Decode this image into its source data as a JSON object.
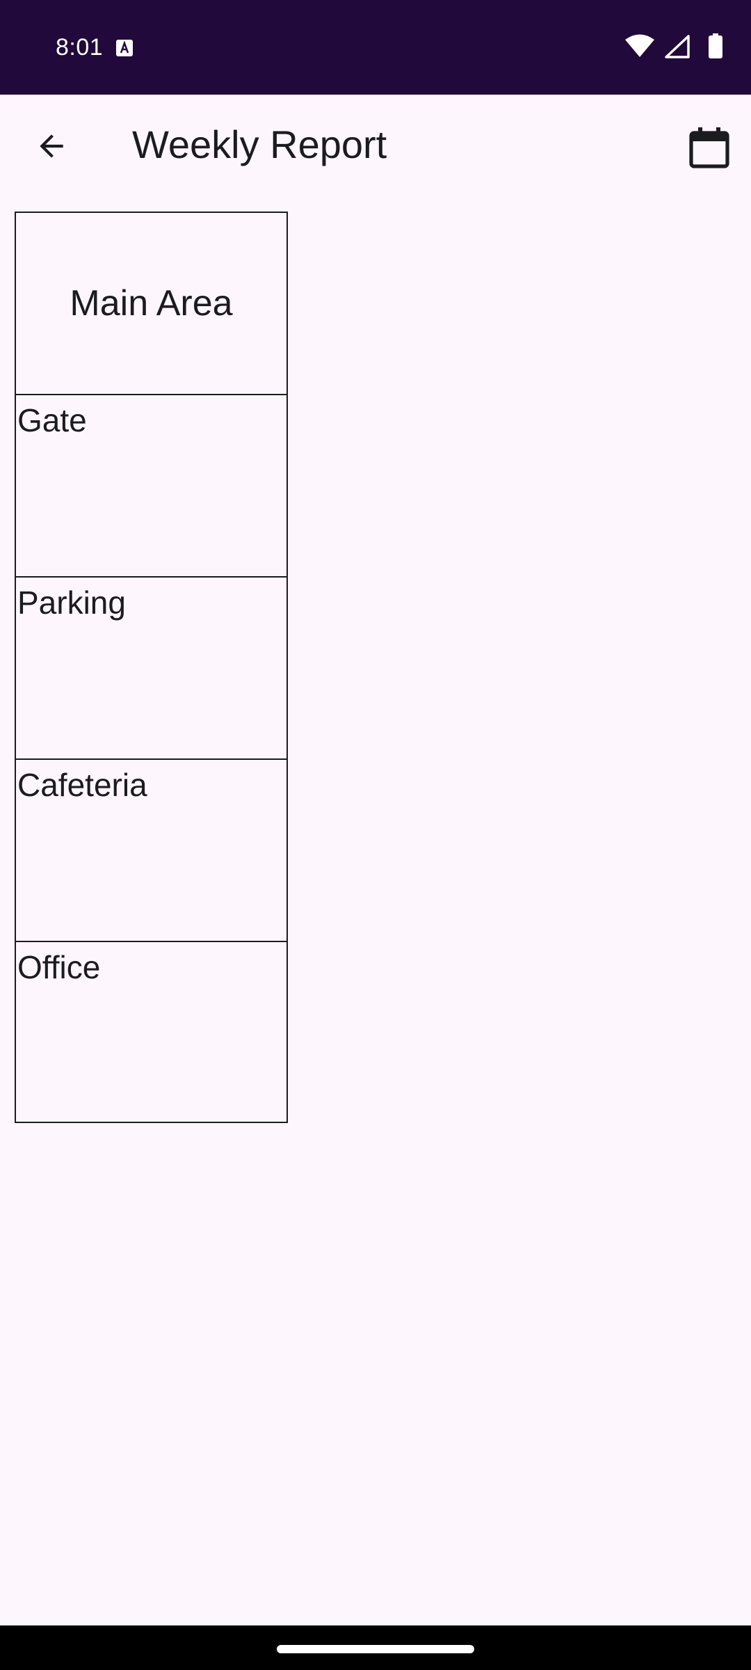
{
  "status_bar": {
    "time": "8:01",
    "icons": [
      "keyboard-a-icon",
      "wifi-icon",
      "signal-icon",
      "battery-icon"
    ]
  },
  "app_bar": {
    "title": "Weekly Report",
    "back_icon": "arrow-back-icon",
    "action_icon": "calendar-icon"
  },
  "table": {
    "header": "Main Area",
    "rows": [
      {
        "label": "Gate"
      },
      {
        "label": "Parking"
      },
      {
        "label": "Cafeteria"
      },
      {
        "label": "Office"
      }
    ]
  },
  "colors": {
    "status_bar_bg": "#21093b",
    "page_bg": "#fdf7fd",
    "text": "#1c1b1f",
    "nav_bar_bg": "#000000"
  }
}
